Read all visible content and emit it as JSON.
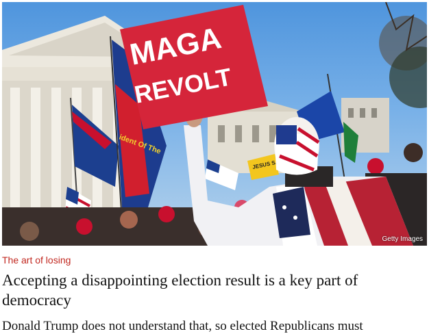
{
  "image": {
    "sign_line1": "MAGA",
    "sign_line2": "REVOLT",
    "credit": "Getty Images",
    "flag_text": "ident Of The",
    "small_sign": "JESUS SAVES"
  },
  "article": {
    "kicker": "The art of losing",
    "headline": "Accepting a disappointing election result is a key part of democracy",
    "standfirst": "Donald Trump does not understand that, so elected Republicans must"
  }
}
